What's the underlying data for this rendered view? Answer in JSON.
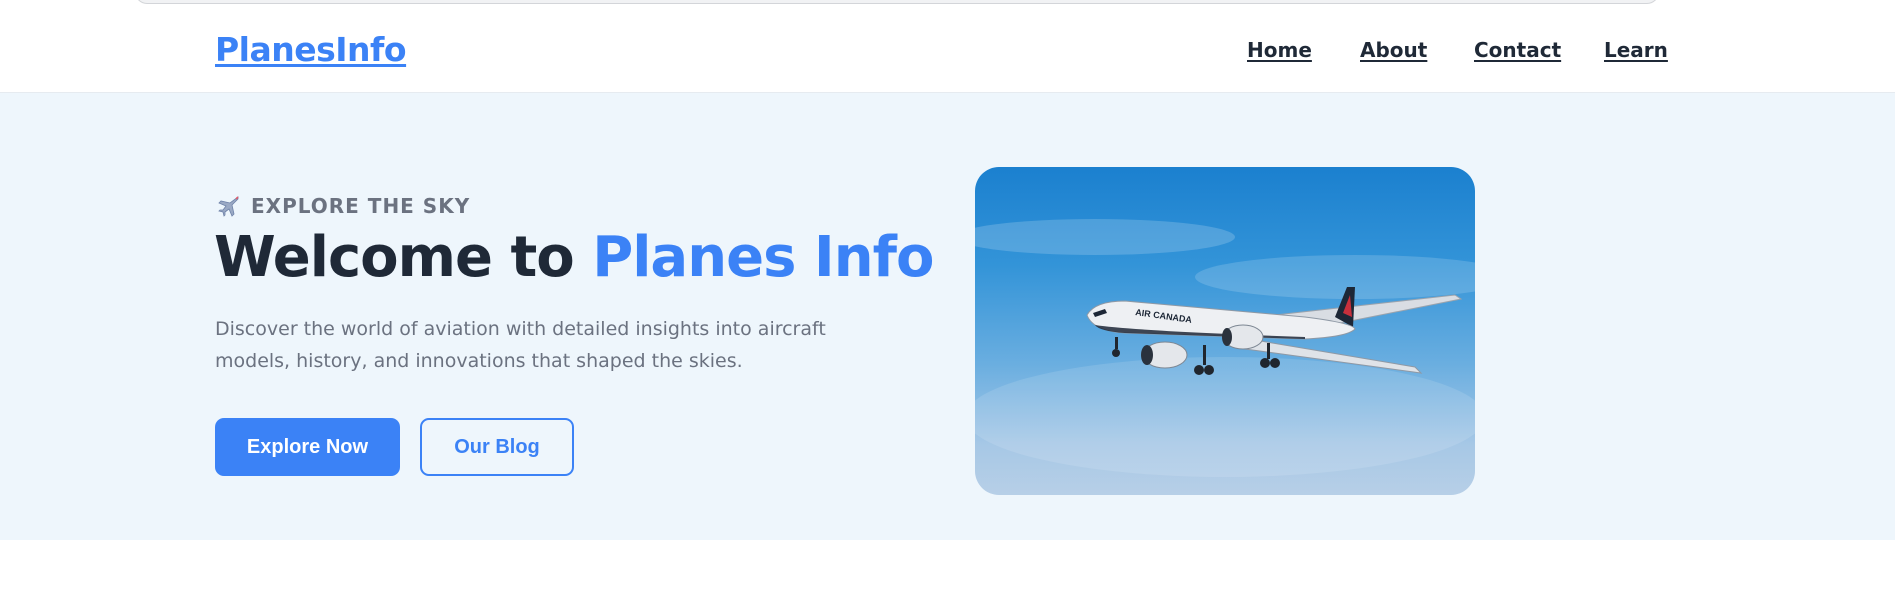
{
  "header": {
    "logo": "PlanesInfo",
    "nav": [
      {
        "label": "Home"
      },
      {
        "label": "About"
      },
      {
        "label": "Contact"
      },
      {
        "label": "Learn"
      }
    ]
  },
  "hero": {
    "eyebrow_icon": "airplane-icon",
    "eyebrow": "EXPLORE THE SKY",
    "title_prefix": "Welcome to ",
    "title_accent": "Planes Info",
    "description": "Discover the world of aviation with detailed insights into aircraft models, history, and innovations that shaped the skies.",
    "primary_button": "Explore Now",
    "secondary_button": "Our Blog",
    "image_text": "AIR CANADA"
  },
  "colors": {
    "accent": "#3b82f6",
    "heading": "#1f2937",
    "muted": "#6b7280",
    "hero_bg": "#eef6fc"
  }
}
